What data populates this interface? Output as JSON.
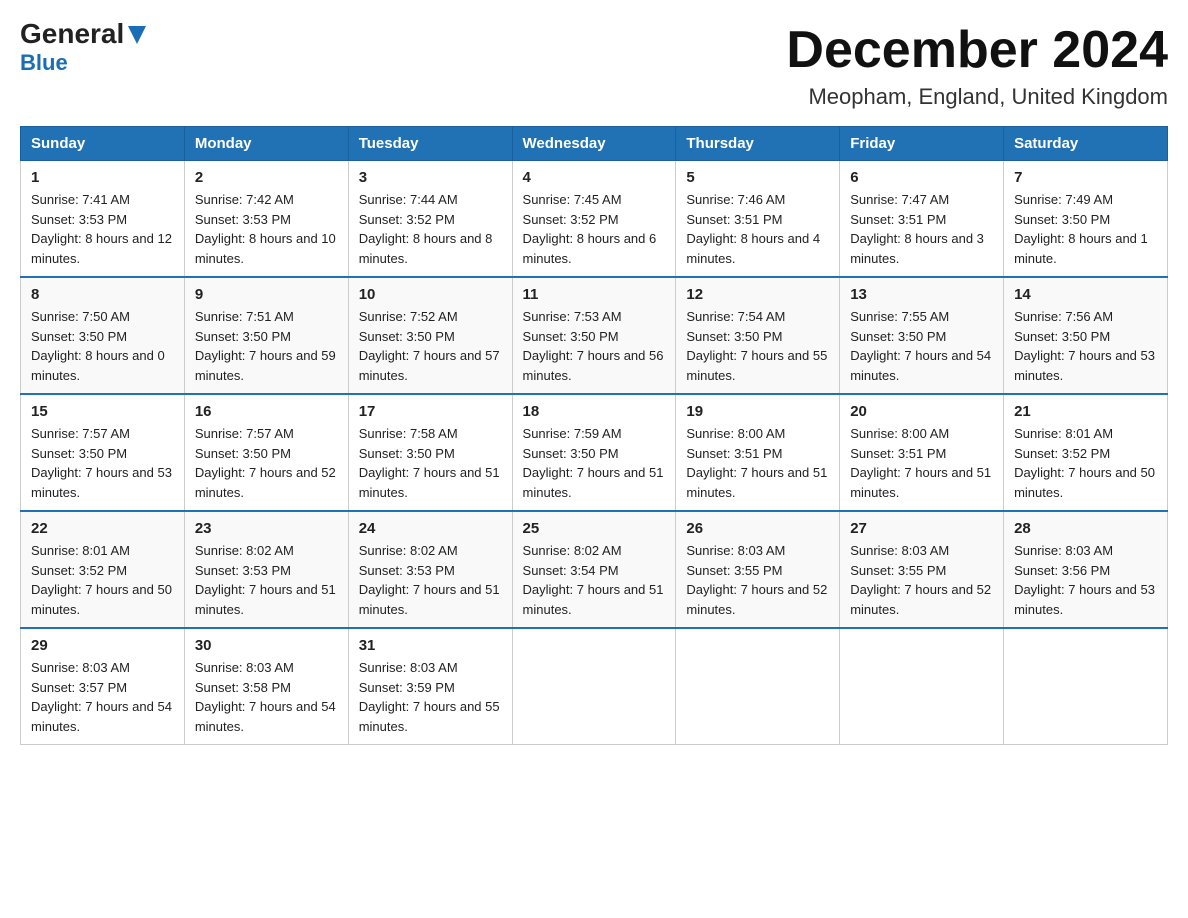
{
  "header": {
    "logo_general": "General",
    "logo_blue": "Blue",
    "title": "December 2024",
    "subtitle": "Meopham, England, United Kingdom"
  },
  "days_of_week": [
    "Sunday",
    "Monday",
    "Tuesday",
    "Wednesday",
    "Thursday",
    "Friday",
    "Saturday"
  ],
  "weeks": [
    [
      {
        "day": "1",
        "sunrise": "7:41 AM",
        "sunset": "3:53 PM",
        "daylight": "8 hours and 12 minutes."
      },
      {
        "day": "2",
        "sunrise": "7:42 AM",
        "sunset": "3:53 PM",
        "daylight": "8 hours and 10 minutes."
      },
      {
        "day": "3",
        "sunrise": "7:44 AM",
        "sunset": "3:52 PM",
        "daylight": "8 hours and 8 minutes."
      },
      {
        "day": "4",
        "sunrise": "7:45 AM",
        "sunset": "3:52 PM",
        "daylight": "8 hours and 6 minutes."
      },
      {
        "day": "5",
        "sunrise": "7:46 AM",
        "sunset": "3:51 PM",
        "daylight": "8 hours and 4 minutes."
      },
      {
        "day": "6",
        "sunrise": "7:47 AM",
        "sunset": "3:51 PM",
        "daylight": "8 hours and 3 minutes."
      },
      {
        "day": "7",
        "sunrise": "7:49 AM",
        "sunset": "3:50 PM",
        "daylight": "8 hours and 1 minute."
      }
    ],
    [
      {
        "day": "8",
        "sunrise": "7:50 AM",
        "sunset": "3:50 PM",
        "daylight": "8 hours and 0 minutes."
      },
      {
        "day": "9",
        "sunrise": "7:51 AM",
        "sunset": "3:50 PM",
        "daylight": "7 hours and 59 minutes."
      },
      {
        "day": "10",
        "sunrise": "7:52 AM",
        "sunset": "3:50 PM",
        "daylight": "7 hours and 57 minutes."
      },
      {
        "day": "11",
        "sunrise": "7:53 AM",
        "sunset": "3:50 PM",
        "daylight": "7 hours and 56 minutes."
      },
      {
        "day": "12",
        "sunrise": "7:54 AM",
        "sunset": "3:50 PM",
        "daylight": "7 hours and 55 minutes."
      },
      {
        "day": "13",
        "sunrise": "7:55 AM",
        "sunset": "3:50 PM",
        "daylight": "7 hours and 54 minutes."
      },
      {
        "day": "14",
        "sunrise": "7:56 AM",
        "sunset": "3:50 PM",
        "daylight": "7 hours and 53 minutes."
      }
    ],
    [
      {
        "day": "15",
        "sunrise": "7:57 AM",
        "sunset": "3:50 PM",
        "daylight": "7 hours and 53 minutes."
      },
      {
        "day": "16",
        "sunrise": "7:57 AM",
        "sunset": "3:50 PM",
        "daylight": "7 hours and 52 minutes."
      },
      {
        "day": "17",
        "sunrise": "7:58 AM",
        "sunset": "3:50 PM",
        "daylight": "7 hours and 51 minutes."
      },
      {
        "day": "18",
        "sunrise": "7:59 AM",
        "sunset": "3:50 PM",
        "daylight": "7 hours and 51 minutes."
      },
      {
        "day": "19",
        "sunrise": "8:00 AM",
        "sunset": "3:51 PM",
        "daylight": "7 hours and 51 minutes."
      },
      {
        "day": "20",
        "sunrise": "8:00 AM",
        "sunset": "3:51 PM",
        "daylight": "7 hours and 51 minutes."
      },
      {
        "day": "21",
        "sunrise": "8:01 AM",
        "sunset": "3:52 PM",
        "daylight": "7 hours and 50 minutes."
      }
    ],
    [
      {
        "day": "22",
        "sunrise": "8:01 AM",
        "sunset": "3:52 PM",
        "daylight": "7 hours and 50 minutes."
      },
      {
        "day": "23",
        "sunrise": "8:02 AM",
        "sunset": "3:53 PM",
        "daylight": "7 hours and 51 minutes."
      },
      {
        "day": "24",
        "sunrise": "8:02 AM",
        "sunset": "3:53 PM",
        "daylight": "7 hours and 51 minutes."
      },
      {
        "day": "25",
        "sunrise": "8:02 AM",
        "sunset": "3:54 PM",
        "daylight": "7 hours and 51 minutes."
      },
      {
        "day": "26",
        "sunrise": "8:03 AM",
        "sunset": "3:55 PM",
        "daylight": "7 hours and 52 minutes."
      },
      {
        "day": "27",
        "sunrise": "8:03 AM",
        "sunset": "3:55 PM",
        "daylight": "7 hours and 52 minutes."
      },
      {
        "day": "28",
        "sunrise": "8:03 AM",
        "sunset": "3:56 PM",
        "daylight": "7 hours and 53 minutes."
      }
    ],
    [
      {
        "day": "29",
        "sunrise": "8:03 AM",
        "sunset": "3:57 PM",
        "daylight": "7 hours and 54 minutes."
      },
      {
        "day": "30",
        "sunrise": "8:03 AM",
        "sunset": "3:58 PM",
        "daylight": "7 hours and 54 minutes."
      },
      {
        "day": "31",
        "sunrise": "8:03 AM",
        "sunset": "3:59 PM",
        "daylight": "7 hours and 55 minutes."
      },
      null,
      null,
      null,
      null
    ]
  ],
  "labels": {
    "sunrise": "Sunrise:",
    "sunset": "Sunset:",
    "daylight": "Daylight:"
  }
}
